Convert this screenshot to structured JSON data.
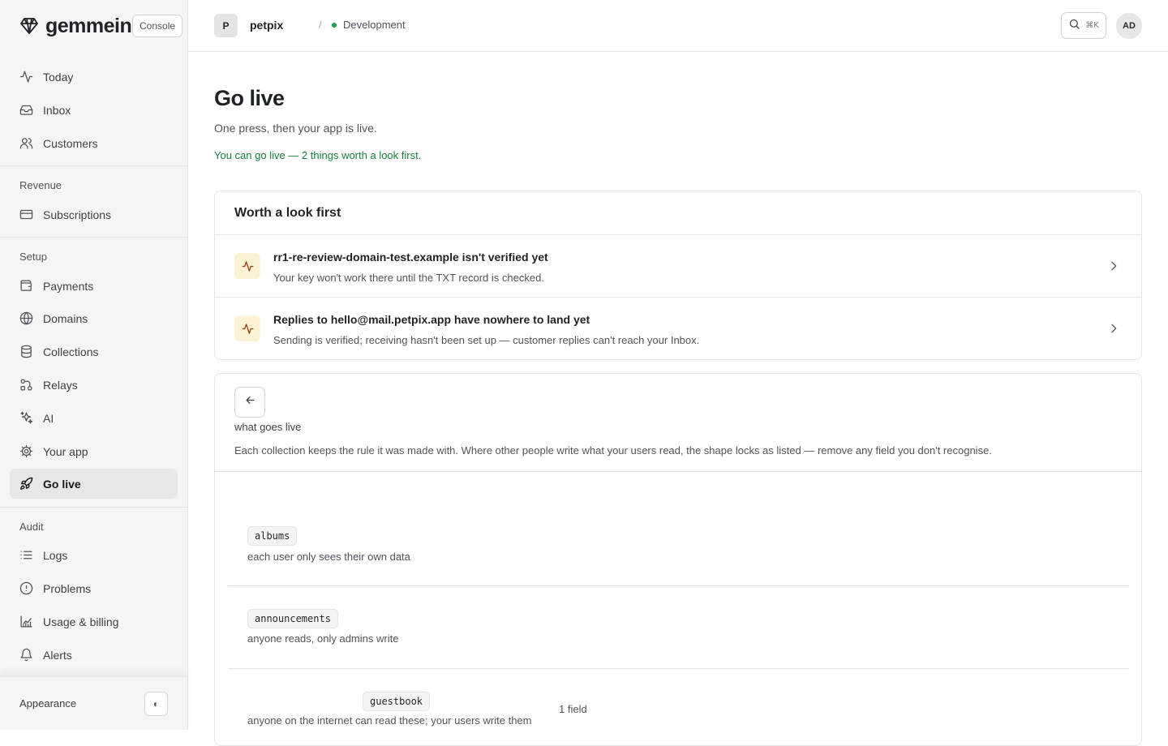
{
  "brand": {
    "name": "gemmein",
    "badge": "Console"
  },
  "sidebar": {
    "main": [
      {
        "label": "Today",
        "icon": "activity-icon"
      },
      {
        "label": "Inbox",
        "icon": "inbox-icon"
      },
      {
        "label": "Customers",
        "icon": "users-icon"
      }
    ],
    "sections": [
      {
        "title": "Revenue",
        "items": [
          {
            "label": "Subscriptions",
            "icon": "credit-card-icon"
          }
        ]
      },
      {
        "title": "Setup",
        "items": [
          {
            "label": "Payments",
            "icon": "wallet-icon"
          },
          {
            "label": "Domains",
            "icon": "globe-icon"
          },
          {
            "label": "Collections",
            "icon": "database-icon"
          },
          {
            "label": "Relays",
            "icon": "relay-icon"
          },
          {
            "label": "AI",
            "icon": "sparkles-icon"
          },
          {
            "label": "Your app",
            "icon": "gear-icon"
          },
          {
            "label": "Go live",
            "icon": "rocket-icon",
            "active": true
          }
        ]
      },
      {
        "title": "Audit",
        "items": [
          {
            "label": "Logs",
            "icon": "list-icon"
          },
          {
            "label": "Problems",
            "icon": "alert-circle-icon"
          },
          {
            "label": "Usage & billing",
            "icon": "chart-icon"
          },
          {
            "label": "Alerts",
            "icon": "bell-icon"
          }
        ]
      }
    ],
    "appearance_label": "Appearance",
    "appearance_toggle": "◐"
  },
  "topbar": {
    "project_initial": "P",
    "project_name": "petpix",
    "separator": "/",
    "environment": "Development",
    "search_shortcut": "⌘K",
    "user_initials": "AD"
  },
  "page": {
    "title": "Go live",
    "subtitle": "One press, then your app is live.",
    "status": "You can go live — 2 things worth a look first."
  },
  "warnings": {
    "heading": "Worth a look first",
    "items": [
      {
        "title": "rr1-re-review-domain-test.example isn't verified yet",
        "description": "Your key won't work there until the TXT record is checked."
      },
      {
        "title": "Replies to hello@mail.petpix.app have nowhere to land yet",
        "description": "Sending is verified; receiving hasn't been set up — customer replies can't reach your Inbox."
      }
    ]
  },
  "live": {
    "heading": "what goes live",
    "description": "Each collection keeps the rule it was made with. Where other people write what your users read, the shape locks as listed — remove any field you don't recognise.",
    "collections": [
      {
        "name": "albums",
        "rule": "each user only sees their own data",
        "fields": ""
      },
      {
        "name": "announcements",
        "rule": "anyone reads, only admins write",
        "fields": ""
      },
      {
        "name": "guestbook",
        "rule": "anyone on the internet can read these; your users write them",
        "fields": "1 field"
      }
    ]
  },
  "colors": {
    "accent_green": "#15803d",
    "warn_bg": "#fdf1d6",
    "active_nav_bg": "#e7e7ea"
  }
}
